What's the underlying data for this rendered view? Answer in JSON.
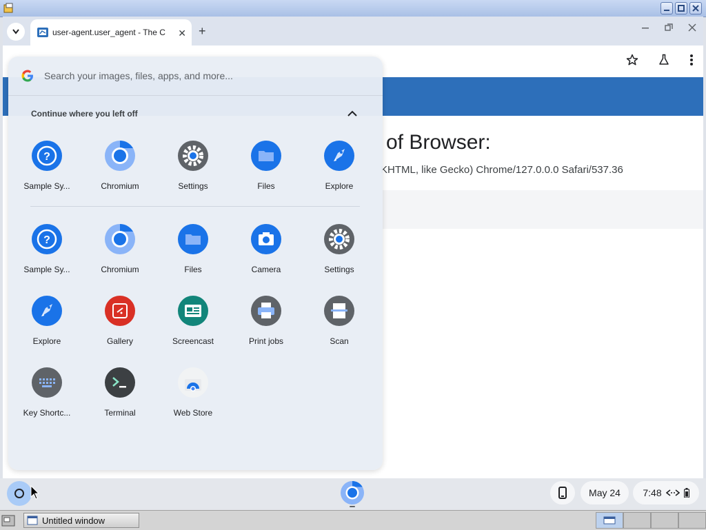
{
  "browser": {
    "tab_title": "user-agent.user_agent - The C",
    "new_tab_glyph": "+",
    "close_glyph": "✕",
    "heading": "of Browser:",
    "ua_string": "KHTML, like Gecko) Chrome/127.0.0.0 Safari/537.36"
  },
  "launcher": {
    "search_placeholder": "Search your images, files, apps, and more...",
    "continue_title": "Continue where you left off",
    "recent": [
      {
        "label": "Sample Sy...",
        "icon": "help-icon"
      },
      {
        "label": "Chromium",
        "icon": "chromium-icon"
      },
      {
        "label": "Settings",
        "icon": "settings-icon"
      },
      {
        "label": "Files",
        "icon": "files-icon"
      },
      {
        "label": "Explore",
        "icon": "explore-icon"
      }
    ],
    "apps": [
      {
        "label": "Sample Sy...",
        "icon": "help-icon"
      },
      {
        "label": "Chromium",
        "icon": "chromium-icon"
      },
      {
        "label": "Files",
        "icon": "files-icon"
      },
      {
        "label": "Camera",
        "icon": "camera-icon"
      },
      {
        "label": "Settings",
        "icon": "settings-icon"
      },
      {
        "label": "Explore",
        "icon": "explore-icon"
      },
      {
        "label": "Gallery",
        "icon": "gallery-icon"
      },
      {
        "label": "Screencast",
        "icon": "screencast-icon"
      },
      {
        "label": "Print jobs",
        "icon": "print-icon"
      },
      {
        "label": "Scan",
        "icon": "scan-icon"
      },
      {
        "label": "Key Shortc...",
        "icon": "keyboard-icon"
      },
      {
        "label": "Terminal",
        "icon": "terminal-icon"
      },
      {
        "label": "Web Store",
        "icon": "webstore-icon"
      }
    ]
  },
  "shelf": {
    "date": "May 24",
    "time": "7:48"
  },
  "taskbar": {
    "window_label": "Untitled window"
  },
  "colors": {
    "accent_blue": "#2d6fba",
    "icon_blue": "#1a73e8",
    "launcher_bg": "#e8edf5"
  }
}
